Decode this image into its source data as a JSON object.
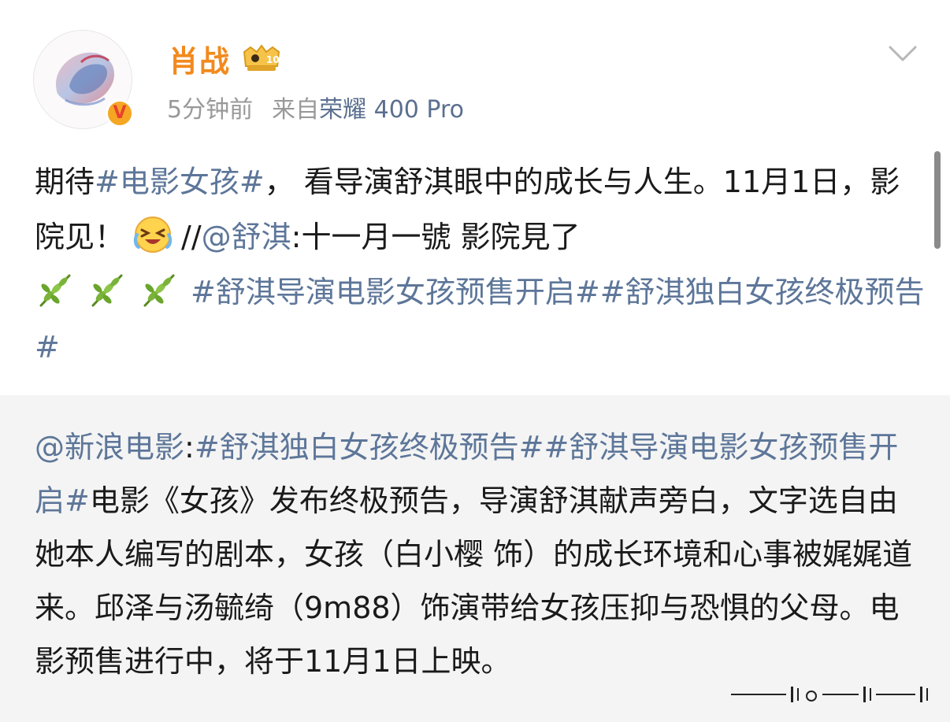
{
  "user": {
    "name": "肖战",
    "avatar": "avatar-image",
    "verified_icon": "verified-v-icon",
    "verified_mark": "V",
    "rank_badge_icon": "crown-rank-badge-icon"
  },
  "meta": {
    "time": "5分钟前",
    "from_label": "来自",
    "device": "荣耀 400 Pro"
  },
  "menu_icon": "chevron-down-icon",
  "post": {
    "part1": "期待",
    "hashtag1": "#电影女孩#",
    "part2": "，  看导演舒淇眼中的成长与人生。11月1日，影院见！",
    "emoji1": "laughing-tears-emoji-icon",
    "repost_marker": "//",
    "mention": "@舒淇",
    "part3": ":十一月一號 影院見了",
    "emoji_branch": "olive-branch-emoji-icon",
    "hashtag2": "#舒淇导演电影女孩预售开启#",
    "hashtag3": "#舒淇独白女孩终极预告#"
  },
  "repost": {
    "mention": "@新浪电影",
    "colon": ":",
    "hashtag1": "#舒淇独白女孩终极预告#",
    "hashtag2": "#舒淇导演电影女孩预售开启#",
    "body": "电影《女孩》发布终极预告，导演舒淇献声旁白，文字选自由她本人编写的剧本，女孩（白小樱 饰）的成长环境和心事被娓娓道来。邱泽与汤毓绮（9m88）饰演带给女孩压抑与恐惧的父母。电影预售进行中，将于11月1日上映。"
  },
  "colors": {
    "username": "#f28a1e",
    "link": "#5d7699",
    "meta": "#999999",
    "repost_bg": "#f4f4f4"
  }
}
